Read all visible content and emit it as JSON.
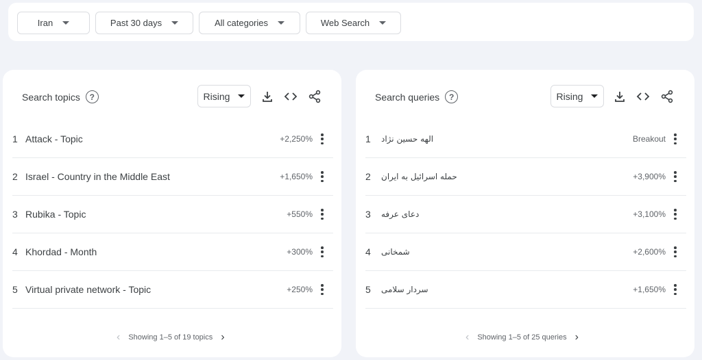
{
  "filters": {
    "region": "Iran",
    "time": "Past 30 days",
    "category": "All categories",
    "source": "Web Search"
  },
  "topics": {
    "title": "Search topics",
    "help_icon": "?",
    "mode": "Rising",
    "items": [
      {
        "rank": "1",
        "label": "Attack - Topic",
        "value": "+2,250%"
      },
      {
        "rank": "2",
        "label": "Israel - Country in the Middle East",
        "value": "+1,650%"
      },
      {
        "rank": "3",
        "label": "Rubika - Topic",
        "value": "+550%"
      },
      {
        "rank": "4",
        "label": "Khordad - Month",
        "value": "+300%"
      },
      {
        "rank": "5",
        "label": "Virtual private network - Topic",
        "value": "+250%"
      }
    ],
    "pager": "Showing 1–5 of 19 topics"
  },
  "queries": {
    "title": "Search queries",
    "help_icon": "?",
    "mode": "Rising",
    "items": [
      {
        "rank": "1",
        "label": "الهه حسین نژاد",
        "value": "Breakout"
      },
      {
        "rank": "2",
        "label": "حمله اسرائیل به ایران",
        "value": "+3,900%"
      },
      {
        "rank": "3",
        "label": "دعای عرفه",
        "value": "+3,100%"
      },
      {
        "rank": "4",
        "label": "شمخانی",
        "value": "+2,600%"
      },
      {
        "rank": "5",
        "label": "سردار سلامی",
        "value": "+1,650%"
      }
    ],
    "pager": "Showing 1–5 of 25 queries"
  },
  "icons": {
    "download": "download-icon",
    "embed": "embed-code-icon",
    "share": "share-icon",
    "more": "more-vert-icon"
  },
  "colors": {
    "background": "#f1f3f8",
    "card": "#ffffff",
    "text": "#3c4043",
    "muted": "#5f6368",
    "divider": "#e8eaed"
  }
}
